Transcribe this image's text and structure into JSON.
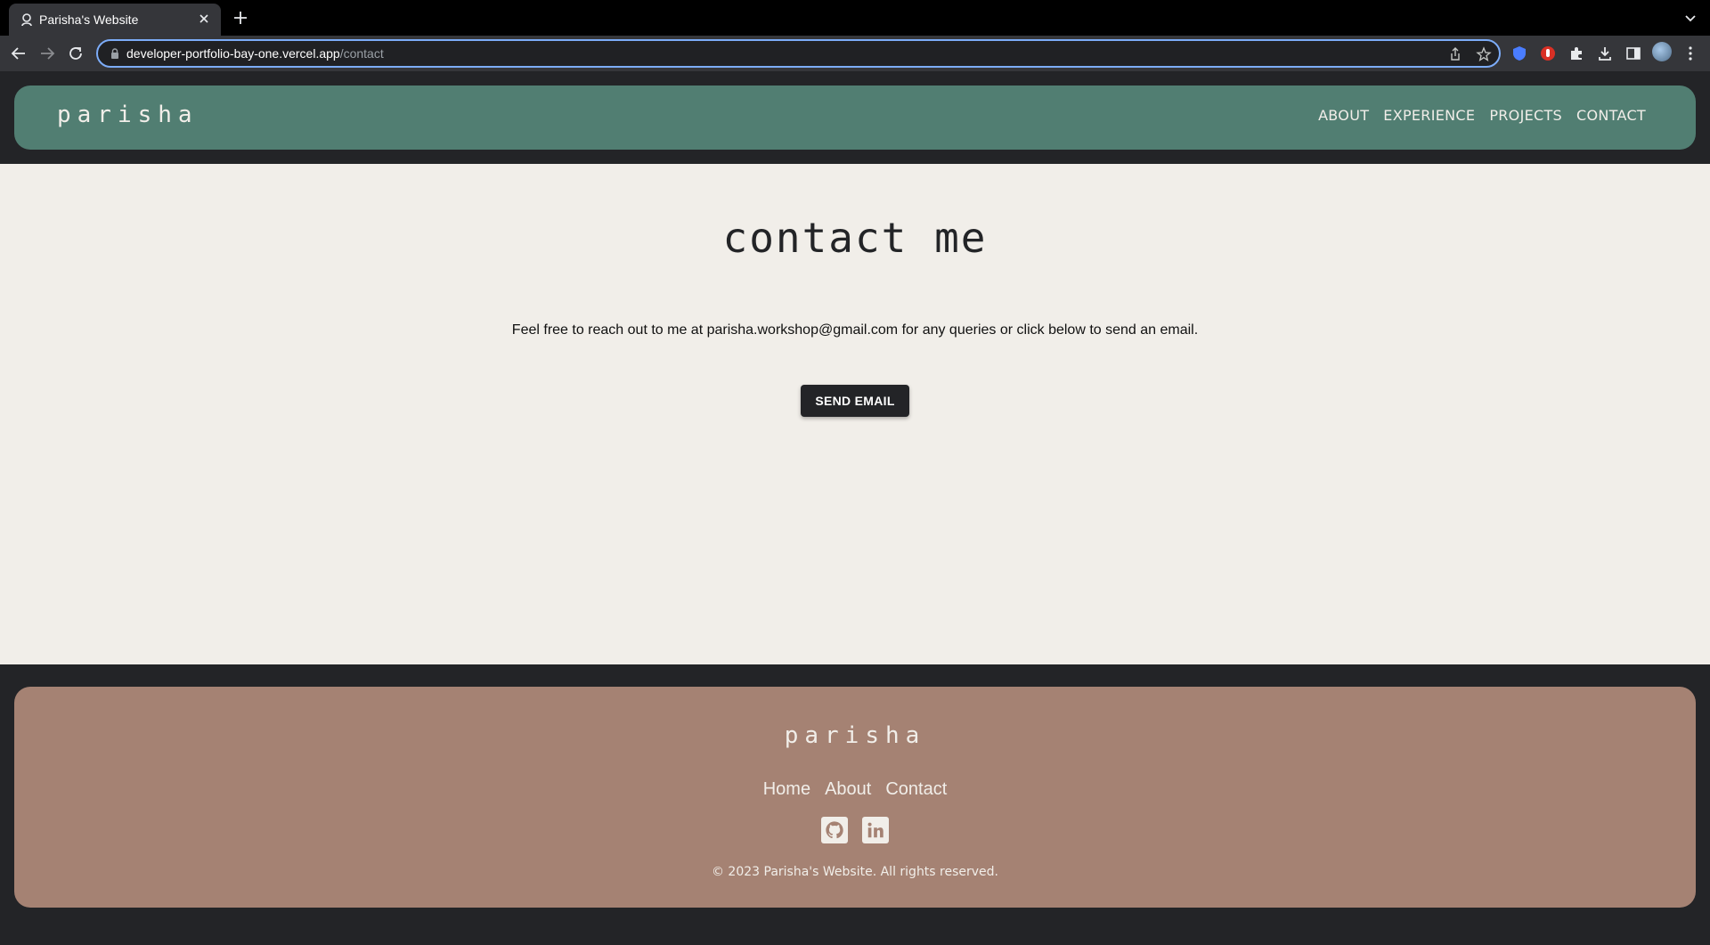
{
  "browser": {
    "tab_title": "Parisha's Website",
    "url_host": "developer-portfolio-bay-one.vercel.app",
    "url_path": "/contact"
  },
  "site": {
    "logo": "Parisha",
    "nav": [
      "ABOUT",
      "EXPERIENCE",
      "PROJECTS",
      "CONTACT"
    ]
  },
  "contact": {
    "heading": "Contact Me",
    "message": "Feel free to reach out to me at parisha.workshop@gmail.com for any queries or click below to send an email.",
    "button_label": "SEND EMAIL"
  },
  "footer": {
    "logo": "Parisha",
    "links": [
      "Home",
      "About",
      "Contact"
    ],
    "social_icons": [
      "github-icon",
      "linkedin-icon"
    ],
    "copyright": "© 2023 Parisha's Website. All rights reserved."
  },
  "colors": {
    "header_bg": "#517e72",
    "footer_bg": "#a58273",
    "page_bg": "#f1eee9",
    "dark": "#232427"
  }
}
